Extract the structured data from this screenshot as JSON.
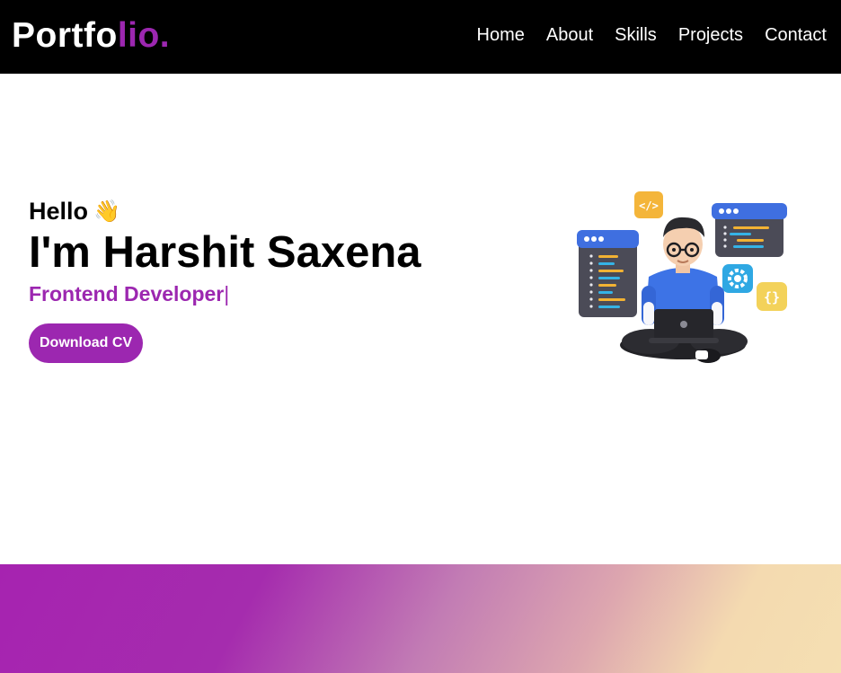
{
  "header": {
    "logo_main": "Portfo",
    "logo_accent": "lio.",
    "nav": [
      "Home",
      "About",
      "Skills",
      "Projects",
      "Contact"
    ]
  },
  "hero": {
    "greeting": "Hello",
    "greeting_icon": "waving-hand-icon",
    "name": "I'm Harshit Saxena",
    "role": "Frontend Developer",
    "caret": "|",
    "button": "Download CV",
    "illustration": "developer-with-laptop-illustration"
  },
  "colors": {
    "accent": "#9c27b0",
    "nav_bg": "#000000",
    "gradient_end": "#f5dfb2"
  }
}
